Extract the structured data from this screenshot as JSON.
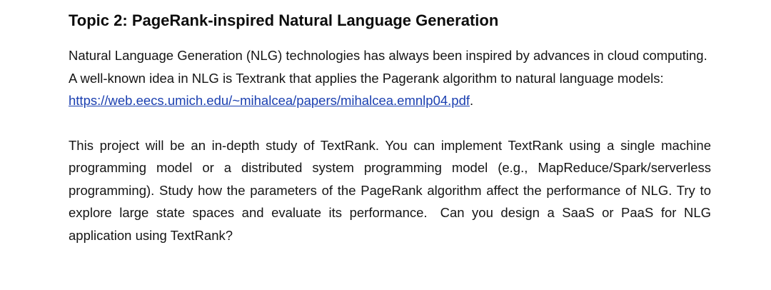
{
  "title": "Topic 2: PageRank-inspired Natural Language Generation",
  "paragraph1": {
    "text_before_link": "Natural Language Generation (NLG) technologies has always been inspired by advances in cloud computing. A well-known idea in NLG is Textrank that applies the Pagerank algorithm to natural language models: ",
    "link_text": "https://web.eecs.umich.edu/~mihalcea/papers/mihalcea.emnlp04.pdf",
    "text_after_link": "."
  },
  "paragraph2": {
    "text_part1": "This project will be an in-depth study of TextRank. You can implement TextRank using a single machine programming model or a distributed system programming model (e.g., MapReduce/Spark/serverless programming). Study how the parameters of the PageRank algorithm affect the performance of NLG. Try to explore large state spaces and evaluate its performance.",
    "text_part2": "Can you design a SaaS or PaaS for NLG application using TextRank?"
  }
}
